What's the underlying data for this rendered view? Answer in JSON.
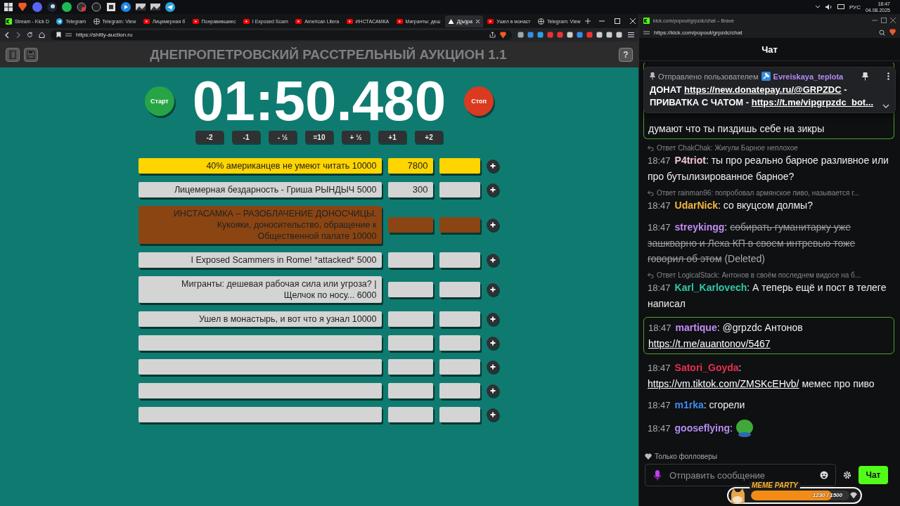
{
  "taskbar": {
    "language": "РУС",
    "time": "18:47",
    "date": "04.08.2025"
  },
  "browser": {
    "tabs": [
      {
        "title": "Stream - Kick D",
        "kind": "kick",
        "selected": false
      },
      {
        "title": "Telegram",
        "kind": "telegram",
        "selected": false
      },
      {
        "title": "Telegram: View",
        "kind": "globe",
        "selected": false
      },
      {
        "title": "Лицемерная б",
        "kind": "video",
        "selected": false
      },
      {
        "title": "Понравившиес",
        "kind": "video",
        "selected": false
      },
      {
        "title": "I Exposed Scam",
        "kind": "video",
        "selected": false
      },
      {
        "title": "American Litera",
        "kind": "video",
        "selected": false
      },
      {
        "title": "ИНСТАСАМКА",
        "kind": "video",
        "selected": false
      },
      {
        "title": "Мигранты: деш",
        "kind": "video",
        "selected": false
      },
      {
        "title": "Д(ы)ра",
        "kind": "site",
        "selected": true
      },
      {
        "title": "Ушел в монаст",
        "kind": "video",
        "selected": false
      },
      {
        "title": "Telegram: View",
        "kind": "globe",
        "selected": false
      }
    ],
    "url": "https://shitty-auction.ru"
  },
  "app": {
    "title": "ДНЕПРОПЕТРОВСКИЙ РАССТРЕЛЬНЫЙ АУКЦИОН 1.1",
    "help": "?",
    "start": "Старт",
    "stop": "Стоп",
    "timer": "01:50.480",
    "adjust": [
      "-2",
      "-1",
      "- ½",
      "=10",
      "+ ½",
      "+1",
      "+2"
    ],
    "lots": [
      {
        "name": "40% американцев не умеют читать 10000",
        "bid": "7800",
        "color": "#ffd500"
      },
      {
        "name": "Лицемерная бездарность - Гриша РЫНДЫЧ 5000",
        "bid": "300",
        "color": "#d4d4d4"
      },
      {
        "name": "ИНСТАСАМКА – РАЗОБЛАЧЕНИЕ ДОНОСЧИЦЫ. Кукояки, доносительство, обращение к Общественной палате 10000",
        "color": "#8b4513"
      },
      {
        "name": "I Exposed Scammers in Rome! *attacked* 5000",
        "color": "#d4d4d4"
      },
      {
        "name": "Мигранты: дешевая рабочая сила или угроза? | Щелчок по носу... 6000",
        "color": "#d4d4d4"
      },
      {
        "name": "Ушел в монастырь, и вот что я узнал 10000",
        "color": "#d4d4d4"
      },
      {
        "color": "#d4d4d4"
      },
      {
        "color": "#d4d4d4"
      },
      {
        "color": "#d4d4d4"
      },
      {
        "color": "#d4d4d4"
      }
    ]
  },
  "chat_window": {
    "title": "kick.com/popout/grpzdc/chat – Brave",
    "url": "https://kick.com/popout/grpzdc/chat",
    "header": "Чат",
    "pinned": {
      "label": "Отправлено пользователем",
      "user": "Evreiskaya_teplota",
      "parts": [
        {
          "kind": "text",
          "text": "ДОНАТ "
        },
        {
          "kind": "link",
          "text": "https://new.donatepay.ru/@GRPZDC"
        },
        {
          "kind": "text",
          "text": " - ПРИВАТКА С ЧАТОМ - "
        },
        {
          "kind": "link",
          "text": "https://t.me/vipgrpzdc_bot..."
        }
      ]
    },
    "messages": [
      {
        "highlighted": true,
        "parts": [
          {
            "kind": "text",
            "text": "думают что ты пиздишь себе на зикры"
          }
        ]
      },
      {
        "reply": "Ответ ChakChak: Жигули Барное неплохое",
        "time": "18:47",
        "user": "P4triot",
        "color": "#f2c4d4",
        "highlighted": false,
        "parts": [
          {
            "kind": "text",
            "text": ": ты про реально барное разливное или про бутылизированное барное?"
          }
        ]
      },
      {
        "reply": "Ответ rainman96: попробовал армянское пиво, называется г...",
        "time": "18:47",
        "user": "UdarNick",
        "color": "#f4b63f",
        "highlighted": false,
        "parts": [
          {
            "kind": "text",
            "text": ": со вкуцсом долмы?"
          }
        ]
      },
      {
        "time": "18:47",
        "user": "streykingg",
        "color": "#c08cf4",
        "highlighted": false,
        "parts": [
          {
            "kind": "text",
            "text": ": "
          },
          {
            "kind": "struck",
            "text": "собирать гуманитарку уже зашкварно и Леха КП в своем интревью тоже говорил об этом"
          },
          {
            "kind": "note",
            "text": " (Deleted)"
          }
        ]
      },
      {
        "reply": "Ответ LogicalStack: Антонов в своём последнем видосе на б...",
        "time": "18:47",
        "user": "Karl_Karlovech",
        "color": "#2fc9a6",
        "highlighted": false,
        "parts": [
          {
            "kind": "text",
            "text": ": А теперь ещё и пост в телеге написал"
          }
        ]
      },
      {
        "time": "18:47",
        "user": "martique",
        "color": "#c48cf5",
        "highlighted": true,
        "parts": [
          {
            "kind": "text",
            "text": ": @grpzdc Антонов "
          },
          {
            "kind": "link",
            "text": "https://t.me/auantonov/5467"
          }
        ]
      },
      {
        "time": "18:47",
        "user": "Satori_Goyda",
        "color": "#e8304c",
        "highlighted": false,
        "parts": [
          {
            "kind": "text",
            "text": ": "
          },
          {
            "kind": "link",
            "text": "https://vm.tiktok.com/ZMSKcEHvb/"
          },
          {
            "kind": "text",
            "text": " мемес про пиво"
          }
        ]
      },
      {
        "time": "18:47",
        "user": "m1rka",
        "color": "#3b8ef0",
        "highlighted": false,
        "parts": [
          {
            "kind": "text",
            "text": ": сгорели"
          }
        ]
      },
      {
        "time": "18:47",
        "user": "gooseflying",
        "color": "#b48cf2",
        "highlighted": false,
        "parts": [
          {
            "kind": "text",
            "text": ":"
          },
          {
            "kind": "emote"
          }
        ]
      }
    ],
    "followers_only": "Только фолловеры",
    "placeholder": "Отправить сообщение",
    "send": "Чат"
  },
  "meme_party": {
    "title": "MEME PARTY",
    "reading": "1230 / 1500",
    "level": 0.82
  }
}
